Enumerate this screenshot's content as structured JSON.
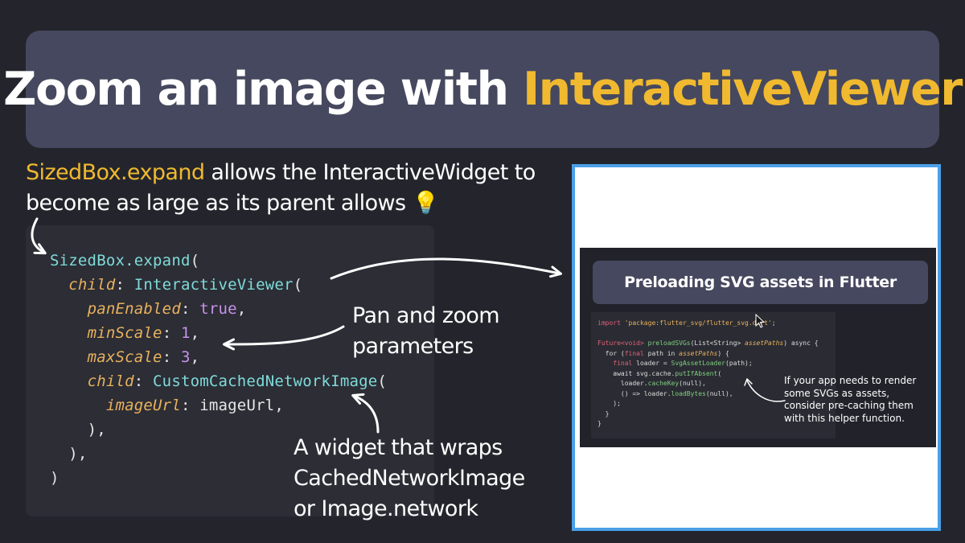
{
  "title": {
    "prefix": "Zoom an image with ",
    "highlight": "InteractiveViewer"
  },
  "description": {
    "highlight": "SizedBox.expand",
    "text": " allows the InteractiveWidget to become as large as its parent allows",
    "emoji": "💡"
  },
  "code": {
    "l1_cls": "SizedBox",
    "l1_fn": ".expand",
    "l1_paren": "(",
    "l2_param": "child",
    "l2_colon": ": ",
    "l2_cls": "InteractiveViewer",
    "l2_paren": "(",
    "l3_param": "panEnabled",
    "l3_colon": ": ",
    "l3_val": "true",
    "l3_end": ",",
    "l4_param": "minScale",
    "l4_colon": ": ",
    "l4_val": "1",
    "l4_end": ",",
    "l5_param": "maxScale",
    "l5_colon": ": ",
    "l5_val": "3",
    "l5_end": ",",
    "l6_param": "child",
    "l6_colon": ": ",
    "l6_cls": "CustomCachedNetworkImage",
    "l6_paren": "(",
    "l7_param": "imageUrl",
    "l7_colon": ": ",
    "l7_val": "imageUrl,",
    "l8": "),",
    "l9": "),",
    "l10": ")"
  },
  "annotations": {
    "pan_zoom_1": "Pan and zoom",
    "pan_zoom_2": "parameters",
    "widget_1": "A widget that wraps",
    "widget_2": "CachedNetworkImage",
    "widget_3": "or Image.network"
  },
  "screenshot": {
    "title": "Preloading SVG assets in Flutter",
    "code": {
      "c1_kw": "import",
      "c1_str": " 'package:flutter_svg/flutter_svg.dart'",
      "c1_end": ";",
      "c2_ty": "Future<void>",
      "c2_fn": " preloadSVGs",
      "c2_a": "(List<String> ",
      "c2_prm": "assetPaths",
      "c2_b": ") async {",
      "c3_a": "  for (",
      "c3_kw": "final",
      "c3_b": " path in ",
      "c3_prm": "assetPaths",
      "c3_c": ") {",
      "c4_a": "    ",
      "c4_kw": "final",
      "c4_b": " loader = ",
      "c4_fn": "SvgAssetLoader",
      "c4_c": "(path);",
      "c5_a": "    await svg.cache.",
      "c5_fn": "putIfAbsent",
      "c5_b": "(",
      "c6_a": "      loader.",
      "c6_fn": "cacheKey",
      "c6_b": "(null),",
      "c7_a": "      () => loader.",
      "c7_fn": "loadBytes",
      "c7_b": "(null),",
      "c8": "    );",
      "c9": "  }",
      "c10": "}"
    },
    "note": "If your app needs to render some SVGs as assets, consider pre-caching them with this helper function."
  },
  "colors": {
    "accent": "#f0b92f",
    "frame": "#4aa0e8",
    "background": "#24252c",
    "title_box": "#45485e"
  }
}
